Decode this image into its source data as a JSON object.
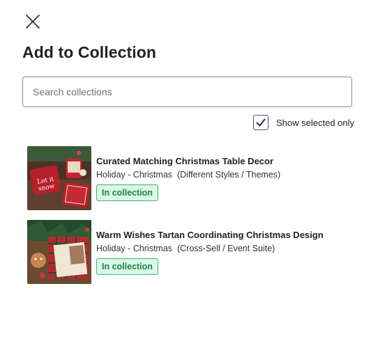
{
  "dialog": {
    "title": "Add to Collection",
    "close_icon": "close-icon"
  },
  "search": {
    "placeholder": "Search collections",
    "value": ""
  },
  "filter": {
    "label": "Show selected only",
    "checked": true,
    "icon": "checkmark-icon"
  },
  "collections": [
    {
      "title": "Curated Matching Christmas Table Decor",
      "subtitle": "Holiday - Christmas  (Different Styles / Themes)",
      "badge": "In collection"
    },
    {
      "title": "Warm Wishes Tartan Coordinating Christmas Design",
      "subtitle": "Holiday - Christmas  (Cross-Sell / Event Suite)",
      "badge": "In collection"
    }
  ],
  "colors": {
    "badge_text": "#158a48",
    "badge_bg": "#dcf5e6",
    "badge_border": "#3cb371",
    "checkbox_check": "#1f3a5f"
  }
}
